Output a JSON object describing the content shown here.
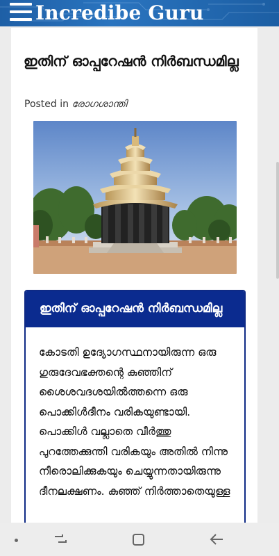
{
  "header": {
    "site_title": "Incredibe Guru",
    "menu_icon": "hamburger-menu-icon"
  },
  "post": {
    "title": "ഇതിന് ഓപ്പറേഷൻ നിർബന്ധമില്ല",
    "posted_in_label": "Posted in",
    "category": "രോഗശാന്തി",
    "image_alt": "temple"
  },
  "infobox": {
    "heading": "ഇതിന് ഓപ്പറേഷൻ നിർബന്ധമില്ല",
    "body": " കോടതി ഉദ്യോഗസ്ഥനായിരുന്ന ഒരു ഗുരുദേവഭക്തന്റെ കുഞ്ഞിന് ശൈശവദശയിൽത്തന്നെ ഒരു പൊക്കിൾദീനം വരികയുണ്ടായി. പൊക്കിൾ വല്ലാതെ വീർത്തു പുറത്തേക്കുന്തി വരികയും അതിൽ നിന്നു നീരൊലിക്കുകയും ചെയ്യുന്നതായിരുന്നു ദീനലക്ഷണം. കുഞ്ഞ് നിർത്താതെയുള്ള"
  },
  "navbar": {
    "icons": [
      "nav-dot-icon",
      "recent-apps-icon",
      "home-icon",
      "back-icon"
    ]
  },
  "colors": {
    "header_blue": "#1e5fa6",
    "infobox_navy": "#0b2b8f",
    "page_bg": "#ececec"
  }
}
